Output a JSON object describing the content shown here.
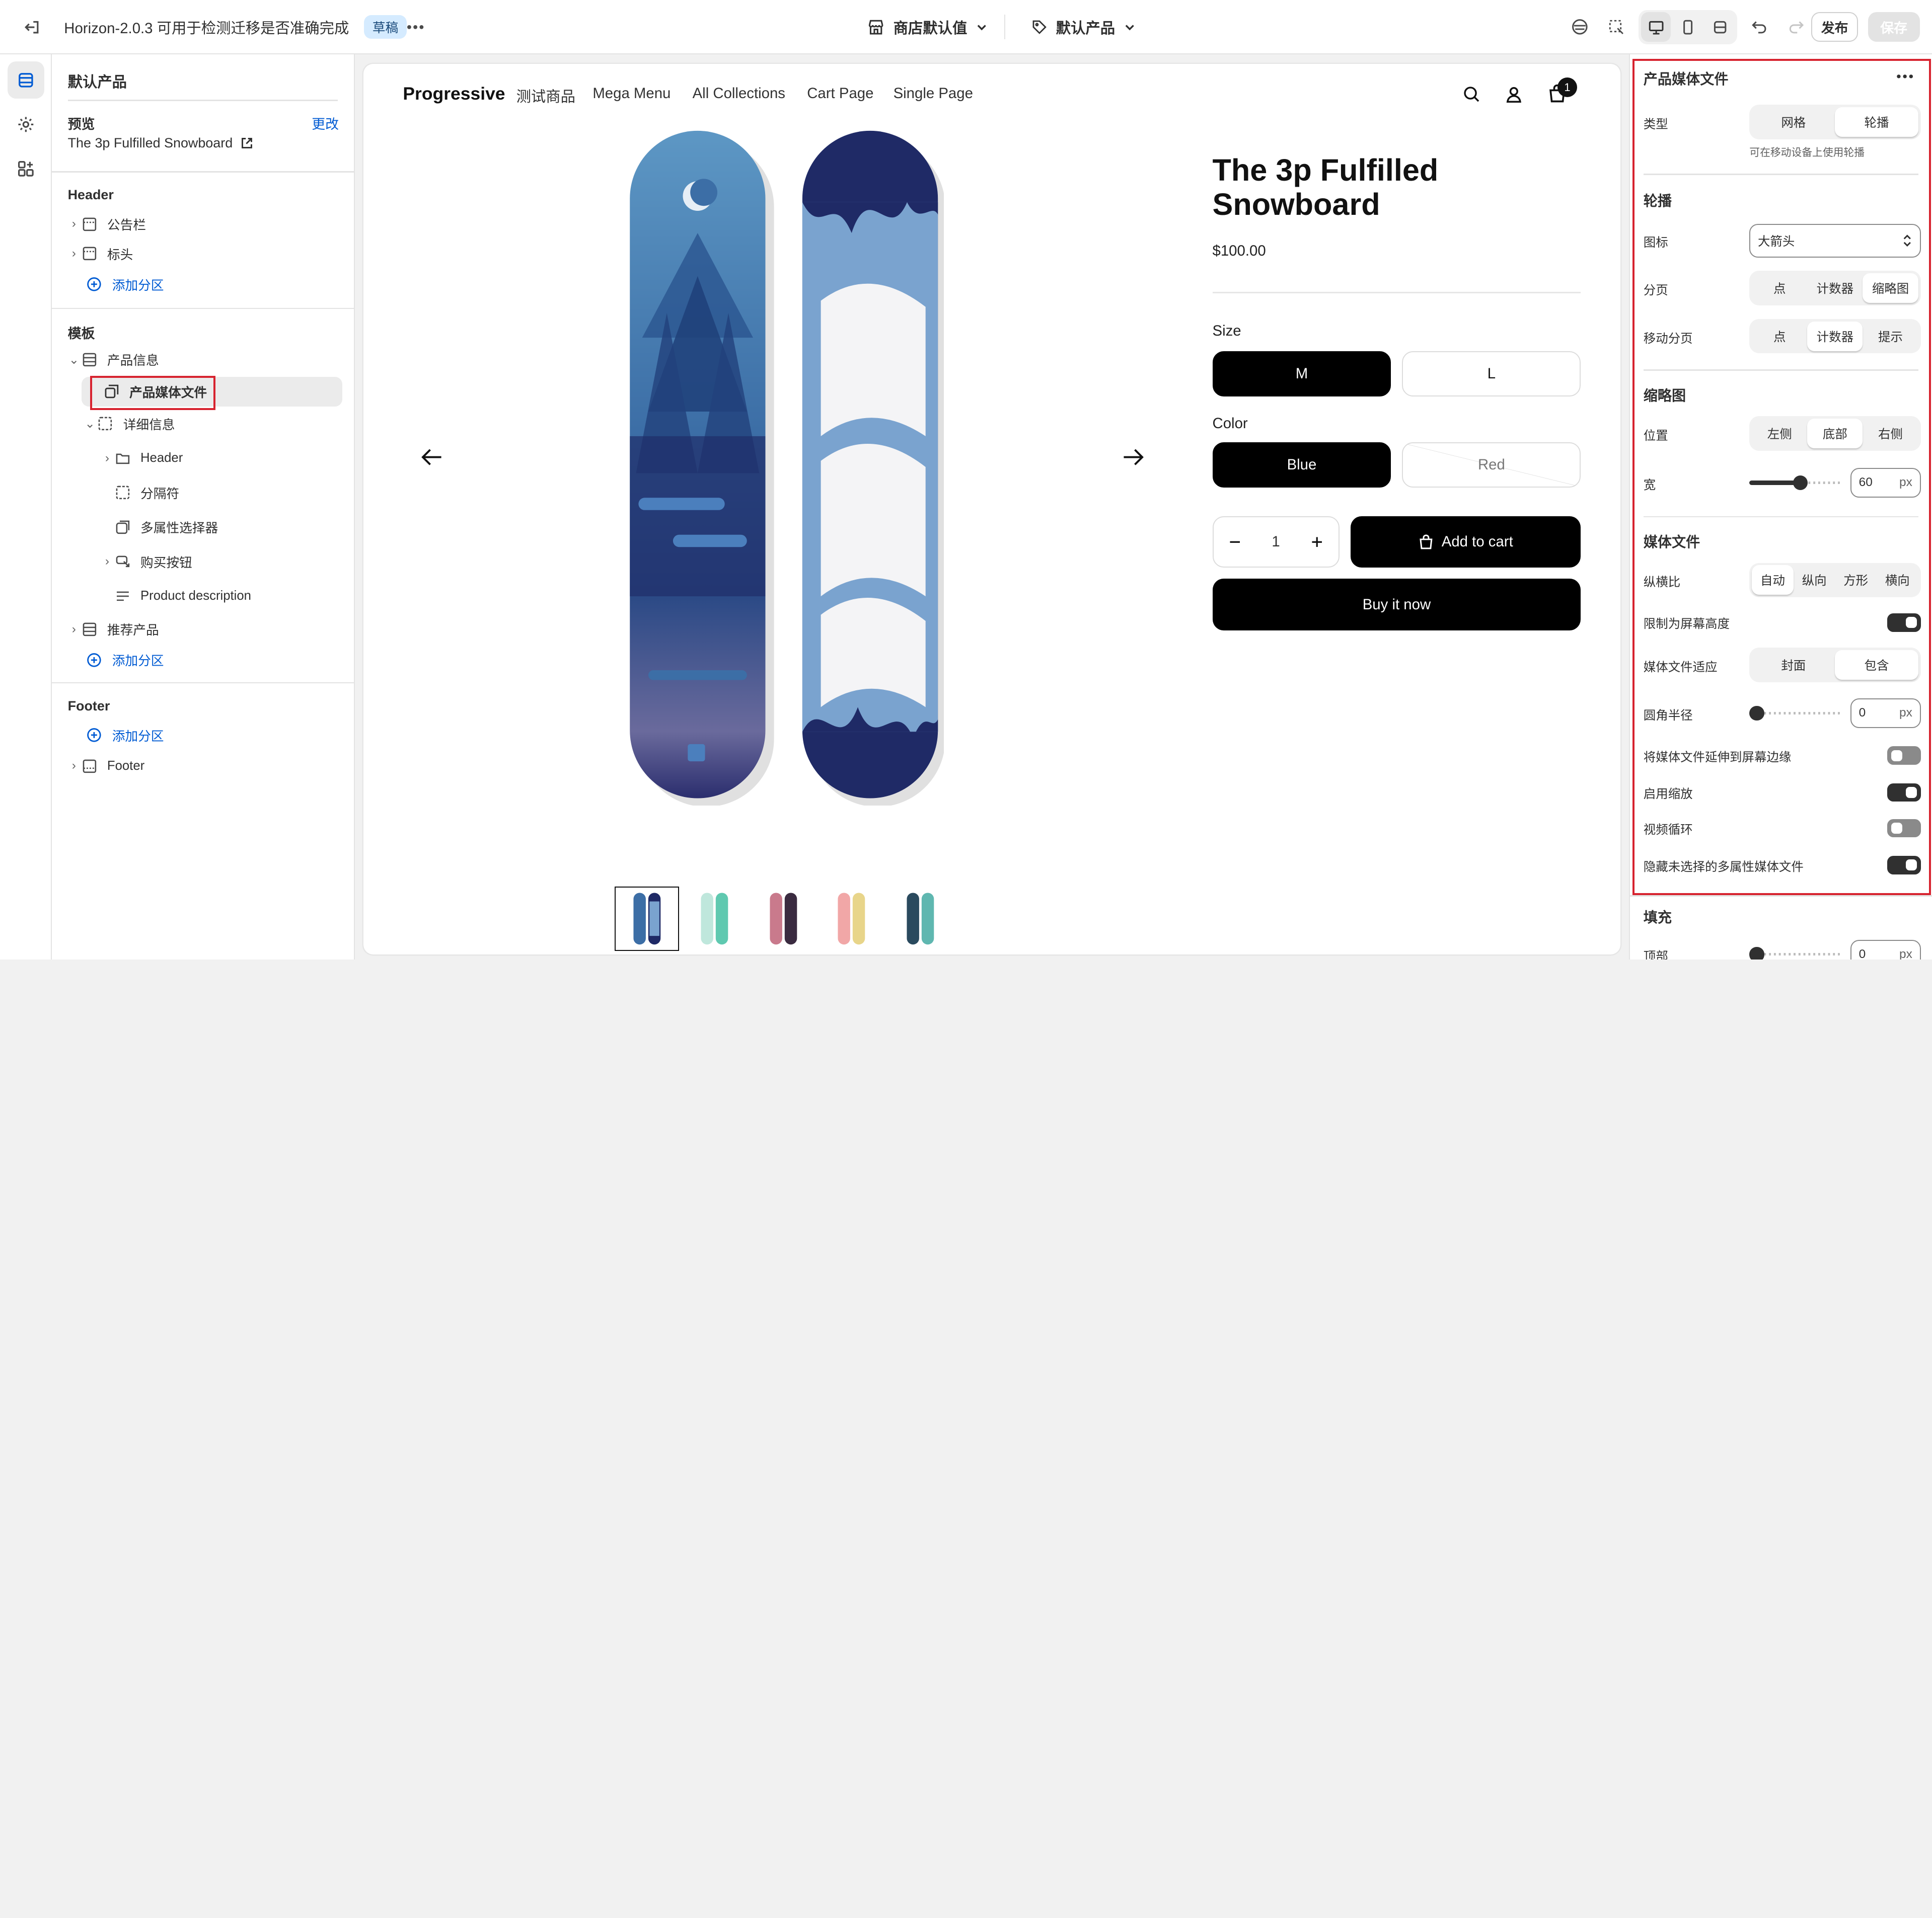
{
  "topbar": {
    "title": "Horizon-2.0.3 可用于检测迁移是否准确完成",
    "badge": "草稿",
    "store_dropdown": "商店默认值",
    "template_dropdown": "默认产品",
    "publish_label": "发布",
    "save_label": "保存"
  },
  "sidebar": {
    "template_name": "默认产品",
    "preview_label": "预览",
    "change_link": "更改",
    "preview_product": "The 3p Fulfilled Snowboard",
    "header_section": "Header",
    "header_items": [
      "公告栏",
      "标头"
    ],
    "add_section": "添加分区",
    "template_section": "模板",
    "product_info": "产品信息",
    "product_media": "产品媒体文件",
    "details": "详细信息",
    "detail_items": [
      "Header",
      "分隔符",
      "多属性选择器",
      "购买按钮",
      "Product description"
    ],
    "recommended": "推荐产品",
    "footer_section": "Footer",
    "footer_item": "Footer"
  },
  "preview": {
    "brand": "Progressive",
    "nav": [
      "测试商品",
      "Mega Menu",
      "All Collections",
      "Cart Page",
      "Single Page"
    ],
    "cart_count": "1",
    "product_title": "The 3p Fulfilled Snowboard",
    "price": "$100.00",
    "size_label": "Size",
    "sizes": [
      "M",
      "L"
    ],
    "color_label": "Color",
    "colors": [
      "Blue",
      "Red"
    ],
    "quantity": "1",
    "add_to_cart": "Add to cart",
    "buy_now": "Buy it now"
  },
  "panel": {
    "title": "产品媒体文件",
    "type_label": "类型",
    "type_options": [
      "网格",
      "轮播"
    ],
    "type_hint": "可在移动设备上使用轮播",
    "carousel_heading": "轮播",
    "icon_label": "图标",
    "icon_value": "大箭头",
    "pagination_label": "分页",
    "pagination_options": [
      "点",
      "计数器",
      "缩略图"
    ],
    "mobile_pagination_label": "移动分页",
    "mobile_pagination_options": [
      "点",
      "计数器",
      "提示"
    ],
    "thumbnails_heading": "缩略图",
    "position_label": "位置",
    "position_options": [
      "左侧",
      "底部",
      "右侧"
    ],
    "width_label": "宽",
    "width_value": "60",
    "width_unit": "px",
    "width_level": 0.56,
    "media_heading": "媒体文件",
    "aspect_label": "纵横比",
    "aspect_options": [
      "自动",
      "纵向",
      "方形",
      "横向"
    ],
    "limit_height_label": "限制为屏幕高度",
    "fit_label": "媒体文件适应",
    "fit_options": [
      "封面",
      "包含"
    ],
    "radius_label": "圆角半径",
    "radius_value": "0",
    "radius_unit": "px",
    "radius_level": 0,
    "extend_label": "将媒体文件延伸到屏幕边缘",
    "zoom_label": "启用缩放",
    "loop_label": "视频循环",
    "hide_label": "隐藏未选择的多属性媒体文件",
    "padding_heading": "填充",
    "top_label": "顶部",
    "top_value": "0",
    "top_unit": "px",
    "toggles": {
      "limit_height": true,
      "extend": false,
      "zoom": true,
      "loop": false,
      "hide": true
    }
  },
  "colors": {
    "highlight_border": "#d7232f",
    "link": "#005bd3",
    "badge_bg": "#d5ebff",
    "toggle_on": "#303030"
  }
}
